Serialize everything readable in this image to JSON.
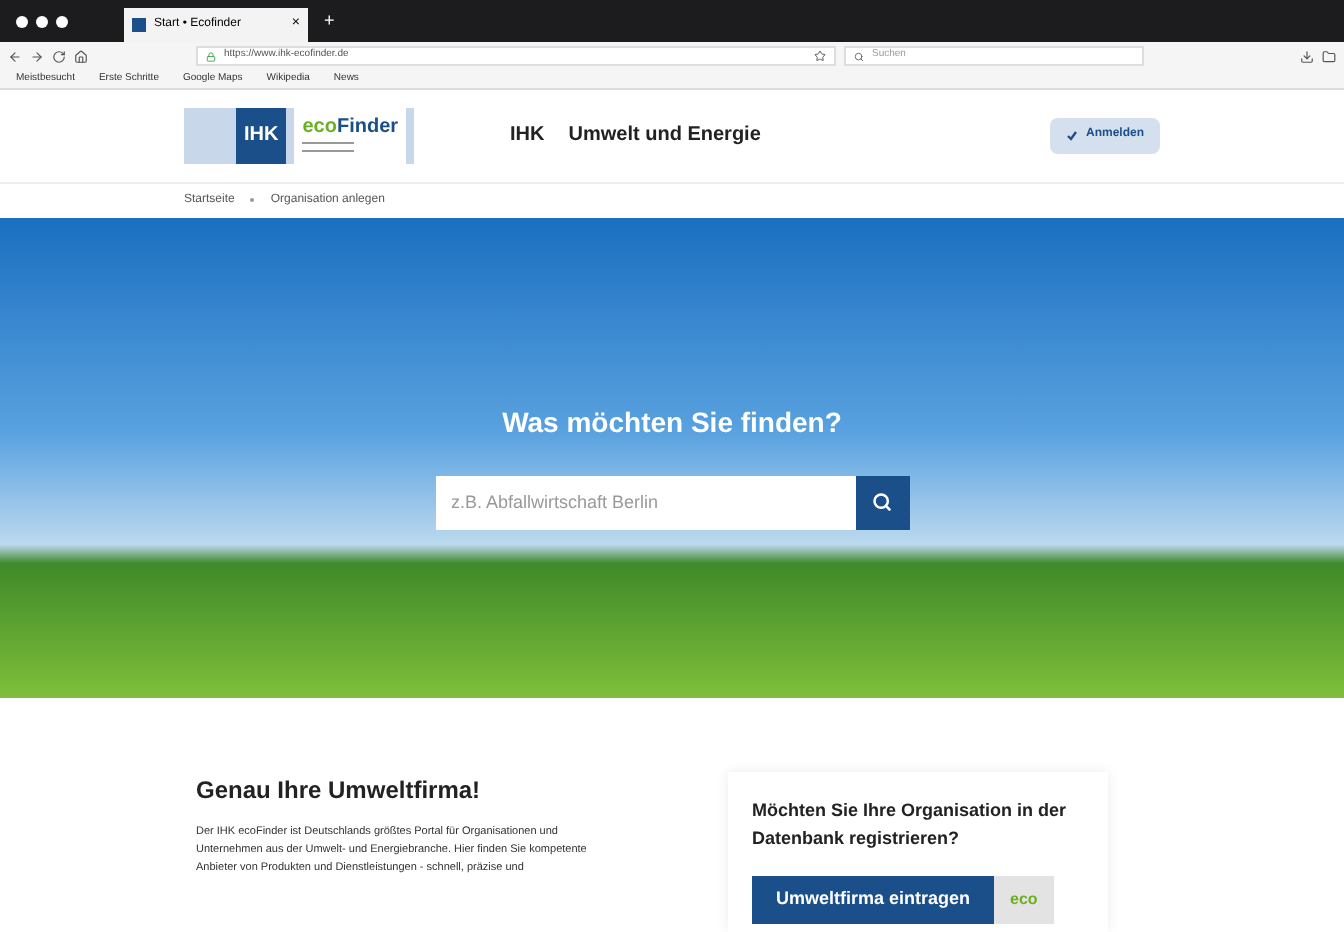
{
  "browser": {
    "tab_title": "Start • Ecofinder",
    "tab_close": "×",
    "new_tab": "+",
    "url": "https://www.ihk-ecofinder.de",
    "search_placeholder": "Suchen",
    "bookmarks": [
      "Meistbesucht",
      "Erste Schritte",
      "Google Maps",
      "Wikipedia",
      "News"
    ]
  },
  "header": {
    "logo": {
      "badge": "IHK",
      "eco": "eco",
      "finder": "Finder"
    },
    "nav": [
      "IHK",
      "Umwelt und Energie"
    ],
    "login_button": "Anmelden"
  },
  "breadcrumb": [
    {
      "label": "Startseite"
    },
    {
      "label": "Organisation anlegen"
    }
  ],
  "hero": {
    "title": "Was möchten Sie finden?",
    "search": {
      "placeholder": "z.B. Abfallwirtschaft Berlin"
    }
  },
  "intro": {
    "title": "Genau Ihre Umweltfirma!",
    "text": "Der IHK ecoFinder ist Deutschlands größtes Portal für Organisationen und Unternehmen aus der Umwelt- und Energiebranche. Hier finden Sie kompetente Anbieter von Produkten und Dienstleistungen - schnell, präzise und"
  },
  "register": {
    "title": "Möchten Sie Ihre Organisation in der Datenbank registrieren?",
    "button": "Umweltfirma eintragen",
    "badge": "eco"
  }
}
